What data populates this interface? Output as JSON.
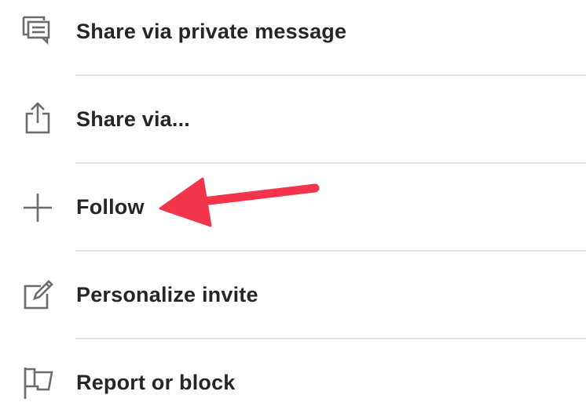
{
  "menu": {
    "items": [
      {
        "label": "Share via private message",
        "icon": "message-bubbles-icon"
      },
      {
        "label": "Share via...",
        "icon": "share-upload-icon"
      },
      {
        "label": "Follow",
        "icon": "plus-icon"
      },
      {
        "label": "Personalize invite",
        "icon": "edit-pencil-icon"
      },
      {
        "label": "Report or block",
        "icon": "flag-icon"
      }
    ]
  },
  "colors": {
    "text": "#262626",
    "icon": "#6b6b6b",
    "divider": "#e3e3e3",
    "annotation_arrow": "#f2354a"
  }
}
